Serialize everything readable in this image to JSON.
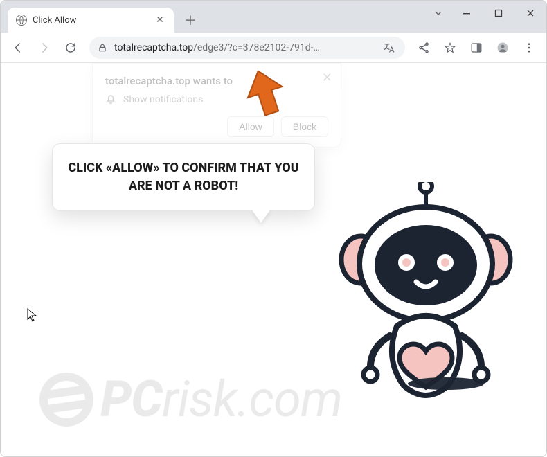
{
  "window": {
    "tab_title": "Click Allow"
  },
  "omnibox": {
    "domain": "totalrecaptcha.top",
    "path": "/edge3/?c=378e2102-791d-…"
  },
  "notification": {
    "origin_wants": "totalrecaptcha.top wants to",
    "permission_label": "Show notifications",
    "allow": "Allow",
    "block": "Block"
  },
  "speech": {
    "text": "CLICK «ALLOW» TO CONFIRM THAT YOU ARE NOT A ROBOT!"
  },
  "watermark": {
    "brand_prefix": "PC",
    "brand_suffix": "risk.com"
  },
  "colors": {
    "robot_outline": "#1c2432",
    "robot_pink": "#f6c4c0",
    "arrow": "#e1671d"
  }
}
